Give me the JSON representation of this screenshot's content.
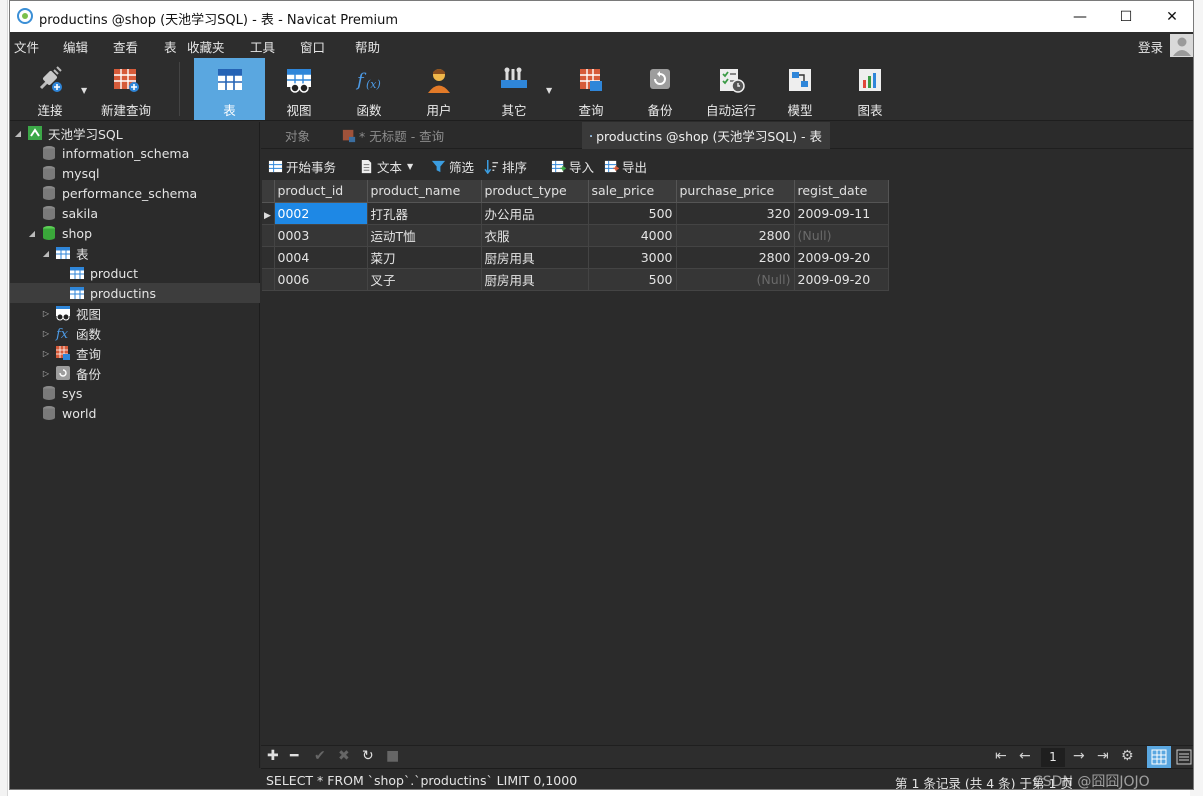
{
  "window": {
    "title": "productins @shop (天池学习SQL) - 表 - Navicat Premium",
    "minimize": "—",
    "maximize": "☐",
    "close": "✕"
  },
  "menu": {
    "items": [
      "文件",
      "编辑",
      "查看",
      "表",
      "收藏夹",
      "工具",
      "窗口",
      "帮助"
    ],
    "login": "登录"
  },
  "toolbar": {
    "items": [
      {
        "label": "连接",
        "icon": "plug-icon"
      },
      {
        "label": "新建查询",
        "icon": "new-query-icon"
      },
      {
        "label": "表",
        "icon": "table-icon"
      },
      {
        "label": "视图",
        "icon": "view-icon"
      },
      {
        "label": "函数",
        "icon": "function-icon"
      },
      {
        "label": "用户",
        "icon": "user-icon"
      },
      {
        "label": "其它",
        "icon": "tools-icon"
      },
      {
        "label": "查询",
        "icon": "query-icon"
      },
      {
        "label": "备份",
        "icon": "backup-icon"
      },
      {
        "label": "自动运行",
        "icon": "schedule-icon"
      },
      {
        "label": "模型",
        "icon": "model-icon"
      },
      {
        "label": "图表",
        "icon": "chart-icon"
      }
    ],
    "active": "表"
  },
  "sidebar": {
    "connection": "天池学习SQL",
    "databases": [
      "information_schema",
      "mysql",
      "performance_schema",
      "sakila"
    ],
    "open_db": "shop",
    "tables_folder": "表",
    "tables": [
      "product",
      "productins"
    ],
    "selected_table": "productins",
    "folders": [
      "视图",
      "函数",
      "查询",
      "备份"
    ],
    "other_dbs": [
      "sys",
      "world"
    ]
  },
  "tabs": {
    "objects": "对象",
    "untitled_query": "* 无标题 - 查询",
    "active": "productins @shop (天池学习SQL) - 表"
  },
  "subtoolbar": {
    "begin_tx": "开始事务",
    "text": "文本",
    "filter": "筛选",
    "sort": "排序",
    "import": "导入",
    "export": "导出"
  },
  "grid": {
    "columns": [
      "product_id",
      "product_name",
      "product_type",
      "sale_price",
      "purchase_price",
      "regist_date"
    ],
    "rows": [
      [
        "0002",
        "打孔器",
        "办公用品",
        "500",
        "320",
        "2009-09-11"
      ],
      [
        "0003",
        "运动T恤",
        "衣服",
        "4000",
        "2800",
        "(Null)"
      ],
      [
        "0004",
        "菜刀",
        "厨房用具",
        "3000",
        "2800",
        "2009-09-20"
      ],
      [
        "0006",
        "叉子",
        "厨房用具",
        "500",
        "(Null)",
        "2009-09-20"
      ]
    ]
  },
  "bottombar": {
    "page": "1"
  },
  "status": {
    "sql": "SELECT * FROM `shop`.`productins` LIMIT 0,1000",
    "records": "第 1 条记录 (共 4 条) 于第 1 页",
    "watermark": "CSDN @囧囧JOJO"
  }
}
